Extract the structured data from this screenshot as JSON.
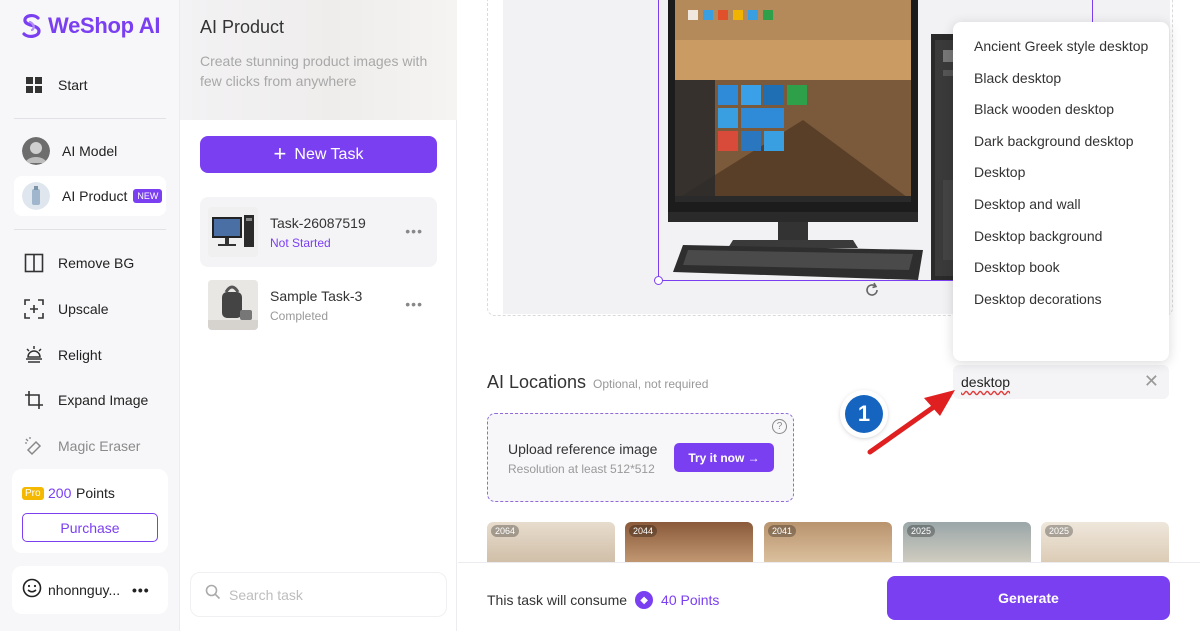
{
  "app": {
    "name": "WeShop AI"
  },
  "nav": {
    "items": [
      {
        "label": "Start"
      },
      {
        "label": "AI Model"
      },
      {
        "label": "AI Product",
        "badge": "NEW"
      },
      {
        "label": "Remove BG"
      },
      {
        "label": "Upscale"
      },
      {
        "label": "Relight"
      },
      {
        "label": "Expand Image"
      },
      {
        "label": "Magic Eraser"
      }
    ],
    "points": {
      "tag": "Pro",
      "value": "200",
      "label": "Points",
      "purchase": "Purchase"
    },
    "user": {
      "name": "nhonnguy..."
    }
  },
  "tasks": {
    "title": "AI Product",
    "subtitle": "Create stunning product images with few clicks from anywhere",
    "new_task": "New Task",
    "list": [
      {
        "name": "Task-26087519",
        "status": "Not Started"
      },
      {
        "name": "Sample Task-3",
        "status": "Completed"
      }
    ],
    "search_placeholder": "Search task"
  },
  "main": {
    "locations": {
      "title": "AI Locations",
      "subtitle": "Optional, not required",
      "input_value": "desktop",
      "suggestions": [
        "Ancient Greek style desktop",
        "Black desktop",
        "Black wooden desktop",
        "Dark background desktop",
        "Desktop",
        "Desktop and wall",
        "Desktop background",
        "Desktop book",
        "Desktop decorations"
      ]
    },
    "upload": {
      "title": "Upload reference image",
      "subtitle": "Resolution at least 512*512",
      "button": "Try it now →"
    },
    "gallery": [
      {
        "count": "2064"
      },
      {
        "count": "2044"
      },
      {
        "count": "2041"
      },
      {
        "count": "2025"
      },
      {
        "count": "2025"
      }
    ],
    "footer": {
      "consume_text": "This task will consume",
      "points": "40 Points",
      "generate": "Generate"
    }
  },
  "annotation": {
    "step": "1"
  },
  "colors": {
    "accent": "#7b3ff2",
    "step_badge": "#1565c0",
    "arrow": "#e02020"
  }
}
